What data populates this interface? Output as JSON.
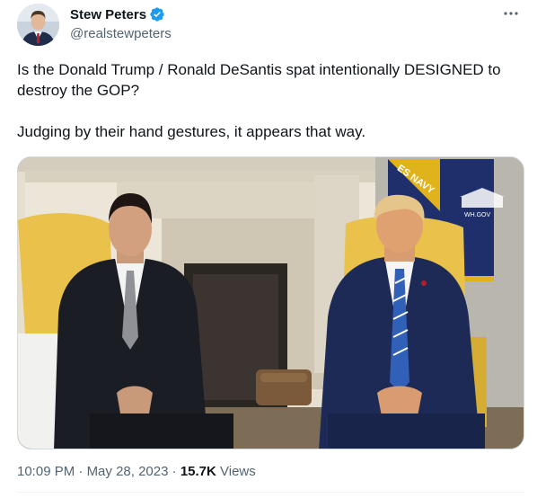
{
  "author": {
    "display_name": "Stew Peters",
    "handle": "@realstewpeters",
    "verified_badge_color": "#1d9bf0"
  },
  "post": {
    "paragraphs": [
      "Is the Donald Trump / Ronald DeSantis spat intentionally DESIGNED to destroy the GOP?",
      "Judging by their hand gestures, it appears that way."
    ]
  },
  "media": {
    "watermark": "WH.GOV",
    "flag_text": "ES NAVY"
  },
  "meta": {
    "time": "10:09 PM",
    "separator": "·",
    "date": "May 28, 2023",
    "views_count": "15.7K",
    "views_label": "Views"
  },
  "icons": {
    "more": "more-horizontal-icon",
    "verified": "verified-badge-icon"
  }
}
